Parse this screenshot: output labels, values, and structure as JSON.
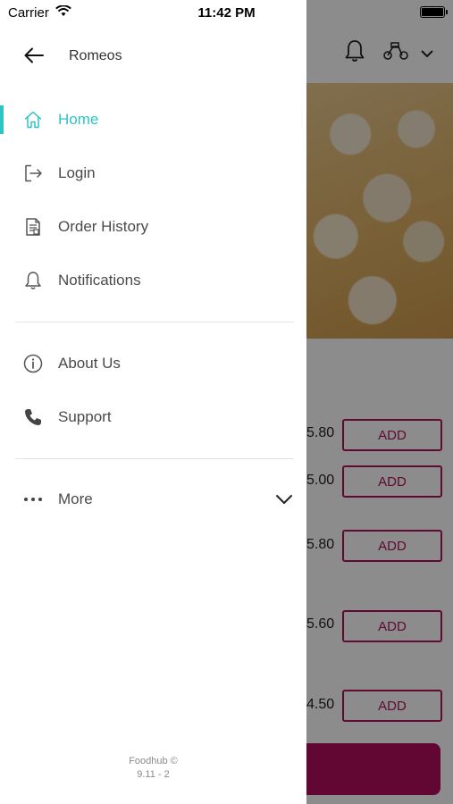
{
  "status_bar": {
    "carrier": "Carrier",
    "time": "11:42 PM"
  },
  "drawer": {
    "restaurant_name": "Romeos",
    "menu_primary": [
      {
        "label": "Home",
        "icon": "home-icon",
        "active": true
      },
      {
        "label": "Login",
        "icon": "login-icon",
        "active": false
      },
      {
        "label": "Order History",
        "icon": "receipt-icon",
        "active": false
      },
      {
        "label": "Notifications",
        "icon": "bell-icon",
        "active": false
      }
    ],
    "menu_secondary": [
      {
        "label": "About Us",
        "icon": "info-icon"
      },
      {
        "label": "Support",
        "icon": "phone-icon"
      }
    ],
    "more": {
      "label": "More",
      "icon": "more-dots-icon"
    },
    "footer": {
      "line1": "Foodhub ©",
      "line2": "9.11 - 2"
    }
  },
  "background": {
    "prices": [
      "5.80",
      "5.00",
      "5.80",
      "5.60",
      "4.50"
    ],
    "add_label": "ADD"
  },
  "colors": {
    "accent": "#2ec4c4",
    "brand": "#b0115a",
    "text": "#4a4a4a"
  }
}
